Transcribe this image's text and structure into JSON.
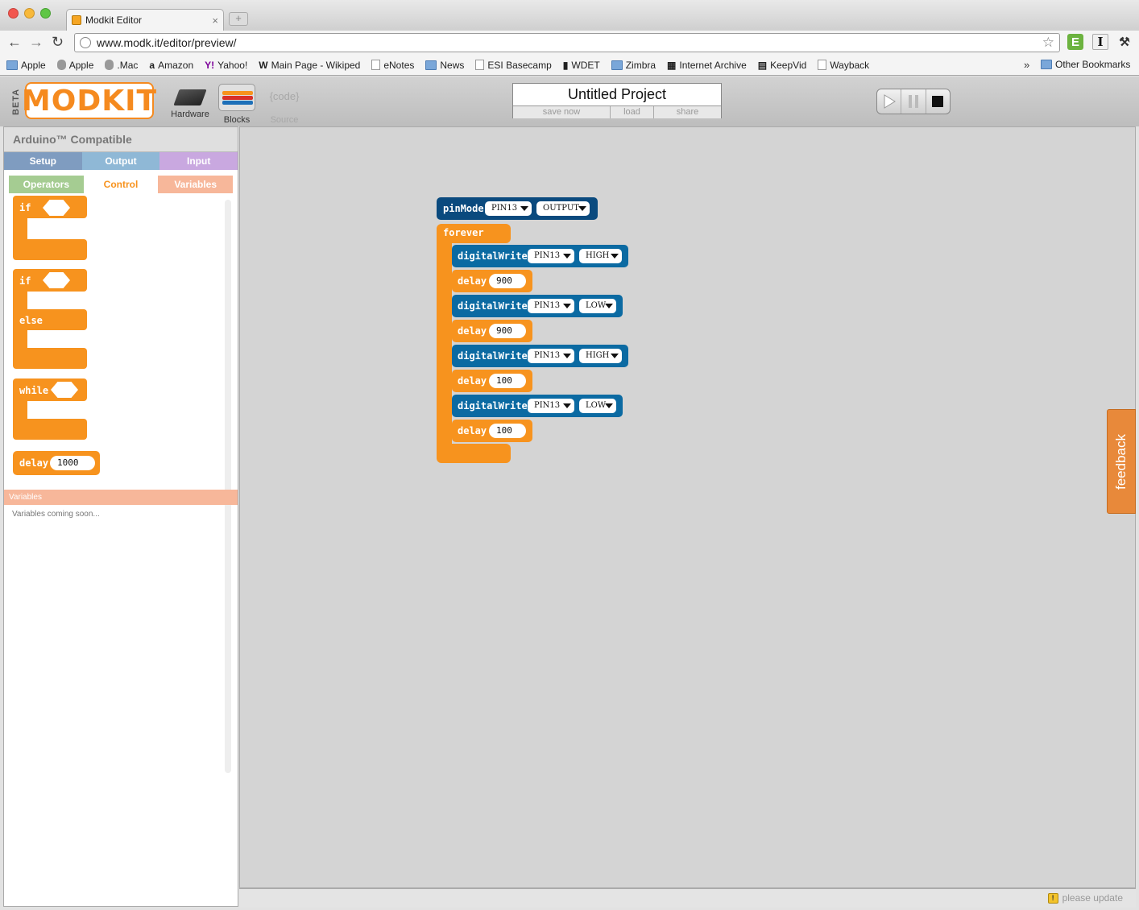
{
  "browser": {
    "tab_title": "Modkit Editor",
    "tab_close": "×",
    "new_tab": "+",
    "url": "www.modk.it/editor/preview/",
    "bookmarks": [
      {
        "label": "Apple",
        "icon": "folder-icon"
      },
      {
        "label": "Apple",
        "icon": "apple-icon"
      },
      {
        "label": ".Mac",
        "icon": "apple-icon"
      },
      {
        "label": "Amazon",
        "icon": "amazon-icon"
      },
      {
        "label": "Yahoo!",
        "icon": "yahoo-icon"
      },
      {
        "label": "Main Page - Wikiped",
        "icon": "wikipedia-icon"
      },
      {
        "label": "eNotes",
        "icon": "page-icon"
      },
      {
        "label": "News",
        "icon": "folder-icon"
      },
      {
        "label": "ESI Basecamp",
        "icon": "page-icon"
      },
      {
        "label": "WDET",
        "icon": "wdet-icon"
      },
      {
        "label": "Zimbra",
        "icon": "folder-icon"
      },
      {
        "label": "Internet Archive",
        "icon": "archive-icon"
      },
      {
        "label": "KeepVid",
        "icon": "keepvid-icon"
      },
      {
        "label": "Wayback",
        "icon": "page-icon"
      }
    ],
    "more": "»",
    "other_bookmarks": "Other Bookmarks"
  },
  "header": {
    "beta": "BETA",
    "logo": "MODKIT",
    "modes": {
      "hardware": "Hardware",
      "blocks": "Blocks",
      "source": "Source",
      "source_icon_text": "{code}"
    },
    "project": {
      "title": "Untitled Project",
      "save": "save now",
      "load": "load",
      "share": "share"
    }
  },
  "palette": {
    "board": "Arduino™ Compatible",
    "categories": [
      {
        "label": "Setup",
        "color": "#7f9cc0"
      },
      {
        "label": "Output",
        "color": "#8fb8d6"
      },
      {
        "label": "Input",
        "color": "#c9a8e0"
      }
    ],
    "subtabs": [
      {
        "label": "Operators",
        "bg": "#a5cc92",
        "fg": "#ffffff"
      },
      {
        "label": "Control",
        "bg": "#ffffff",
        "fg": "#f7931e"
      },
      {
        "label": "Variables",
        "bg": "#f7b79a",
        "fg": "#ffffff"
      }
    ],
    "blocks": {
      "if1": "if",
      "if2": "if",
      "else": "else",
      "while": "while",
      "delay": "delay",
      "delay_value": "1000"
    },
    "variables_header": "Variables",
    "variables_text": "Variables coming soon..."
  },
  "program": {
    "pinmode": {
      "label": "pinMode",
      "pin": "PIN13",
      "mode": "OUTPUT"
    },
    "forever": "forever",
    "statements": [
      {
        "kind": "digitalWrite",
        "label": "digitalWrite",
        "pin": "PIN13",
        "value": "HIGH"
      },
      {
        "kind": "delay",
        "label": "delay",
        "value": "900"
      },
      {
        "kind": "digitalWrite",
        "label": "digitalWrite",
        "pin": "PIN13",
        "value": "LOW"
      },
      {
        "kind": "delay",
        "label": "delay",
        "value": "900"
      },
      {
        "kind": "digitalWrite",
        "label": "digitalWrite",
        "pin": "PIN13",
        "value": "HIGH"
      },
      {
        "kind": "delay",
        "label": "delay",
        "value": "100"
      },
      {
        "kind": "digitalWrite",
        "label": "digitalWrite",
        "pin": "PIN13",
        "value": "LOW"
      },
      {
        "kind": "delay",
        "label": "delay",
        "value": "100"
      }
    ]
  },
  "feedback": "feedback",
  "status": {
    "update": "please update",
    "warn_glyph": "!"
  },
  "colors": {
    "control": "#f7931e",
    "output": "#0b6aa2",
    "setup": "#0a4a7e",
    "canvas": "#d4d4d4"
  }
}
